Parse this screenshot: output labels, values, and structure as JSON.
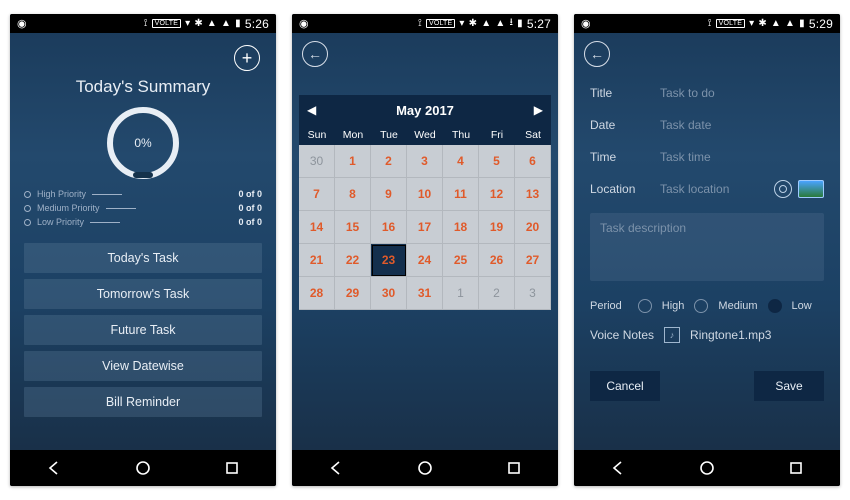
{
  "screens": [
    {
      "status_time": "5:26",
      "summary_title": "Today's Summary",
      "progress_pct": "0%",
      "priorities": [
        {
          "label": "High Priority",
          "count": "0 of 0"
        },
        {
          "label": "Medium Priority",
          "count": "0 of 0"
        },
        {
          "label": "Low Priority",
          "count": "0 of 0"
        }
      ],
      "menu": [
        "Today's Task",
        "Tomorrow's Task",
        "Future Task",
        "View Datewise",
        "Bill Reminder"
      ]
    },
    {
      "status_time": "5:27",
      "calendar": {
        "title": "May 2017",
        "day_labels": [
          "Sun",
          "Mon",
          "Tue",
          "Wed",
          "Thu",
          "Fri",
          "Sat"
        ],
        "cells": [
          {
            "n": "30",
            "muted": true
          },
          {
            "n": "1"
          },
          {
            "n": "2"
          },
          {
            "n": "3"
          },
          {
            "n": "4"
          },
          {
            "n": "5"
          },
          {
            "n": "6"
          },
          {
            "n": "7"
          },
          {
            "n": "8"
          },
          {
            "n": "9"
          },
          {
            "n": "10"
          },
          {
            "n": "11"
          },
          {
            "n": "12"
          },
          {
            "n": "13"
          },
          {
            "n": "14"
          },
          {
            "n": "15"
          },
          {
            "n": "16"
          },
          {
            "n": "17"
          },
          {
            "n": "18"
          },
          {
            "n": "19"
          },
          {
            "n": "20"
          },
          {
            "n": "21"
          },
          {
            "n": "22"
          },
          {
            "n": "23",
            "selected": true
          },
          {
            "n": "24"
          },
          {
            "n": "25"
          },
          {
            "n": "26"
          },
          {
            "n": "27"
          },
          {
            "n": "28"
          },
          {
            "n": "29"
          },
          {
            "n": "30"
          },
          {
            "n": "31"
          },
          {
            "n": "1",
            "muted": true
          },
          {
            "n": "2",
            "muted": true
          },
          {
            "n": "3",
            "muted": true
          }
        ]
      }
    },
    {
      "status_time": "5:29",
      "form": {
        "fields": [
          {
            "label": "Title",
            "placeholder": "Task to do"
          },
          {
            "label": "Date",
            "placeholder": "Task date"
          },
          {
            "label": "Time",
            "placeholder": "Task time"
          },
          {
            "label": "Location",
            "placeholder": "Task location"
          }
        ],
        "description_placeholder": "Task description",
        "period_label": "Period",
        "period_options": [
          "High",
          "Medium",
          "Low"
        ],
        "voice_label": "Voice Notes",
        "voice_file": "Ringtone1.mp3",
        "cancel_label": "Cancel",
        "save_label": "Save"
      }
    }
  ],
  "status_badge": "VOLTE"
}
